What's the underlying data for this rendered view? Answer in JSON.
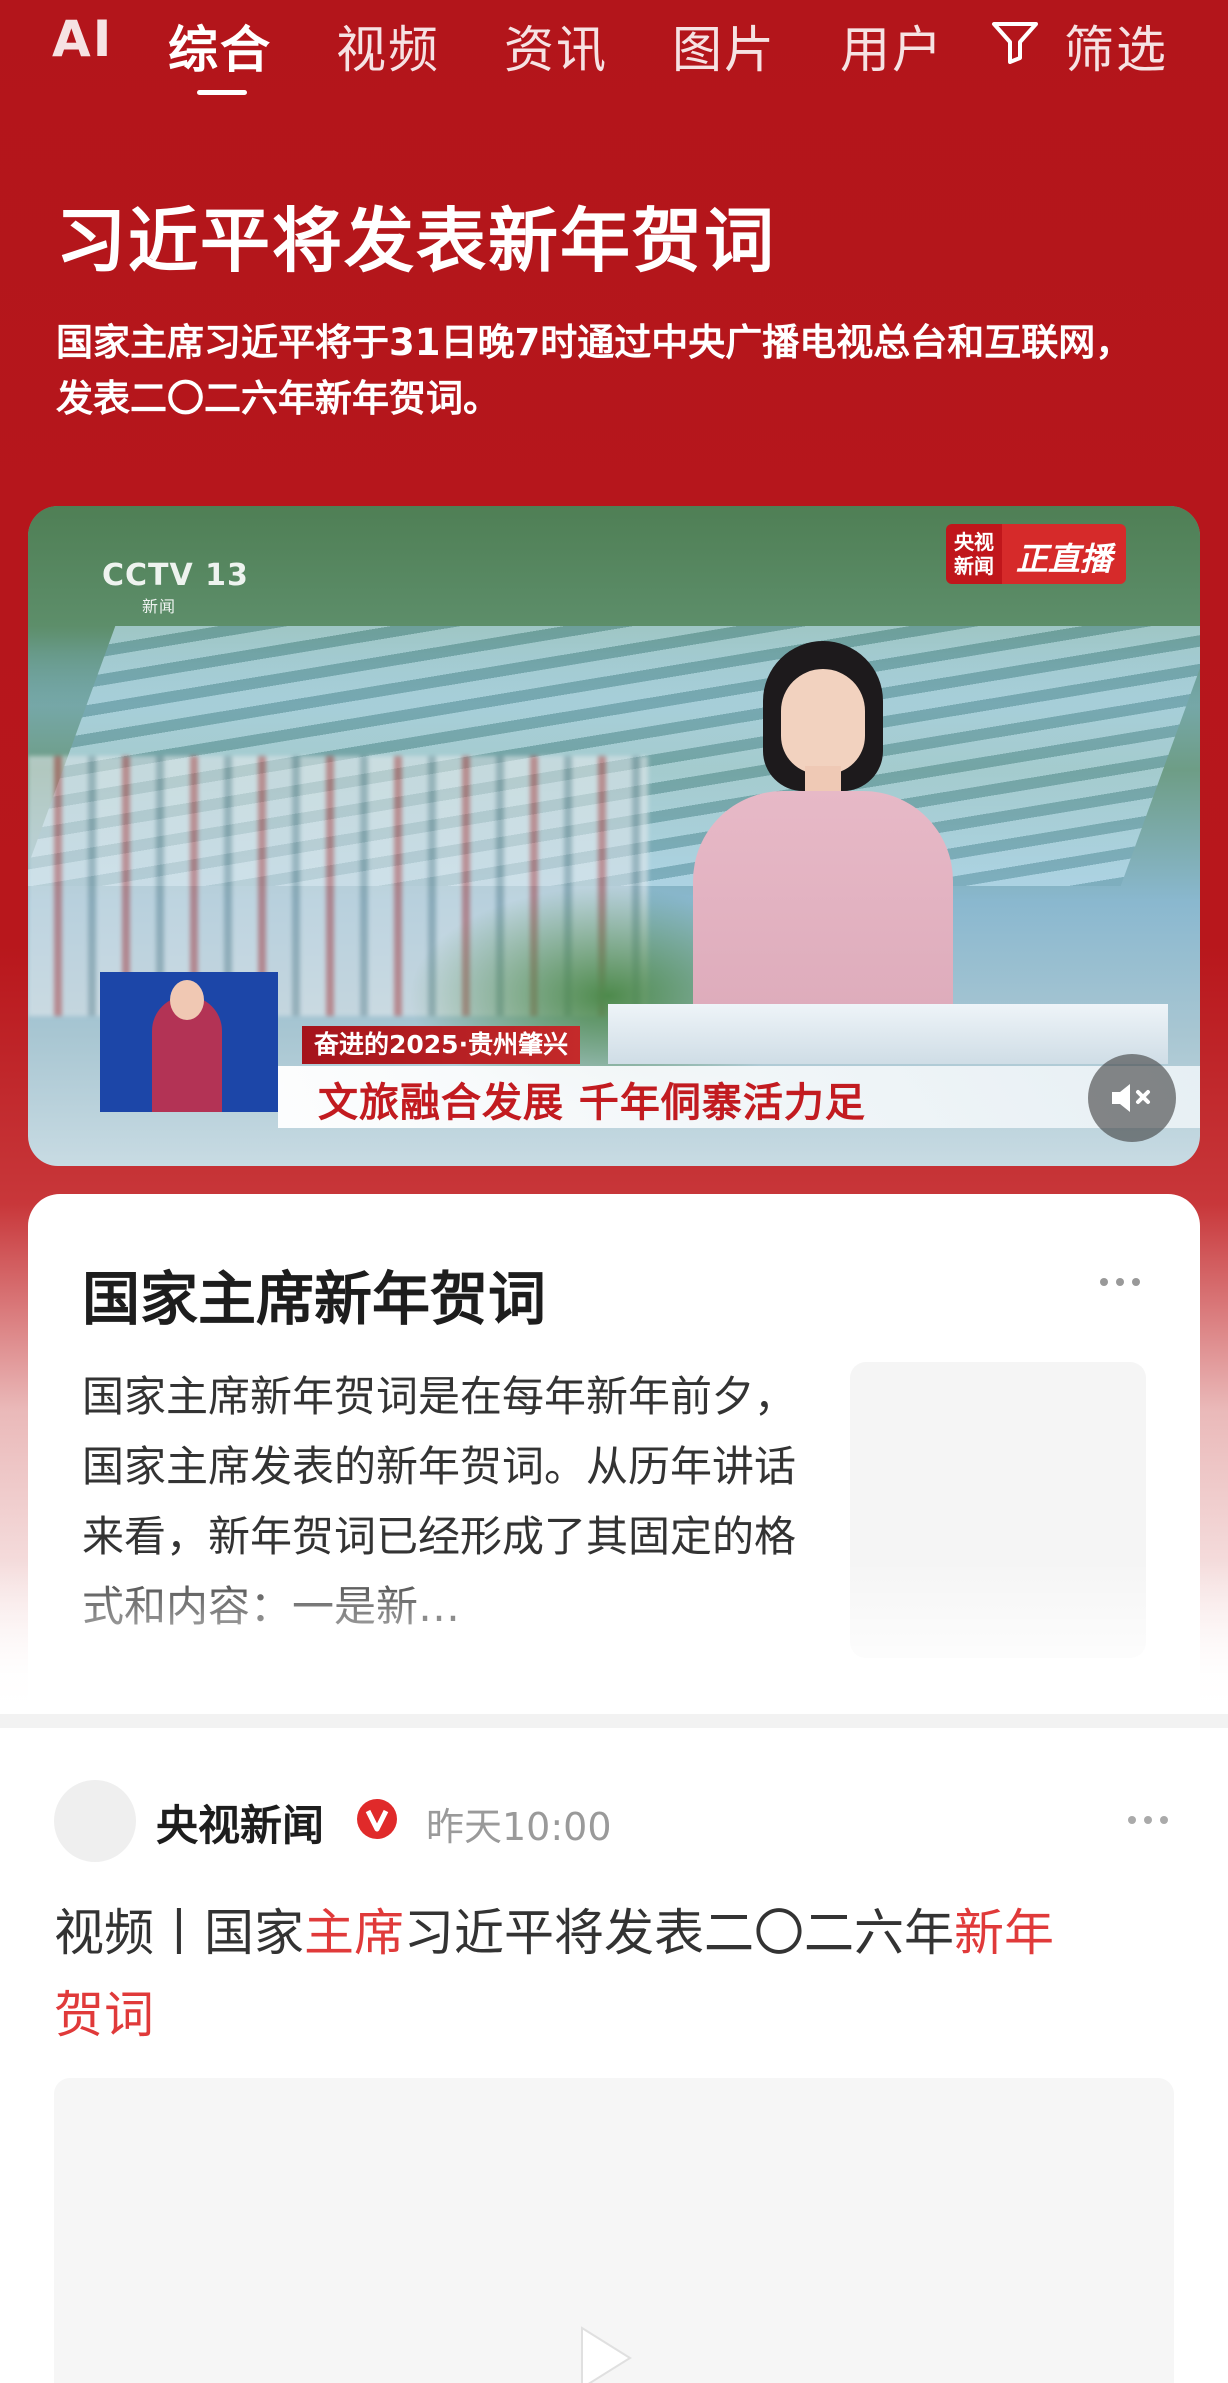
{
  "nav": {
    "tabs": [
      "AI",
      "综合",
      "视频",
      "资讯",
      "图片",
      "用户"
    ],
    "active_tab": "综合",
    "filter_label": "筛选"
  },
  "hero": {
    "title": "习近平将发表新年贺词",
    "description": "国家主席习近平将于31日晚7时通过中央广播电视总台和互联网，发表二〇二六年新年贺词。"
  },
  "video": {
    "channel_logo": "CCTV 13",
    "channel_sub": "新闻",
    "live_badge_source": "央视新闻",
    "live_badge_label": "正直播",
    "lower_third_tag": "奋进的2025·贵州肇兴",
    "lower_third_headline": "文旅融合发展 千年侗寨活力足",
    "muted": true
  },
  "info_card": {
    "title": "国家主席新年贺词",
    "text": "国家主席新年贺词是在每年新年前夕，国家主席发表的新年贺词。从历年讲话来看，新年贺词已经形成了其固定的格式和内容：一是新…"
  },
  "feed_item": {
    "source": "央视新闻",
    "verified_icon": "verified-v-icon",
    "time": "昨天10:00",
    "title_parts": [
      {
        "text": "视频丨国家",
        "highlight": false
      },
      {
        "text": "主席",
        "highlight": true
      },
      {
        "text": "习近平将发表二〇二六年",
        "highlight": false
      },
      {
        "text": "新年",
        "highlight": true
      },
      {
        "text": "贺词",
        "highlight": true
      }
    ]
  },
  "colors": {
    "brand_red": "#b3151b",
    "highlight_red": "#e03a3a",
    "muted_gray": "#9a9a9a"
  }
}
